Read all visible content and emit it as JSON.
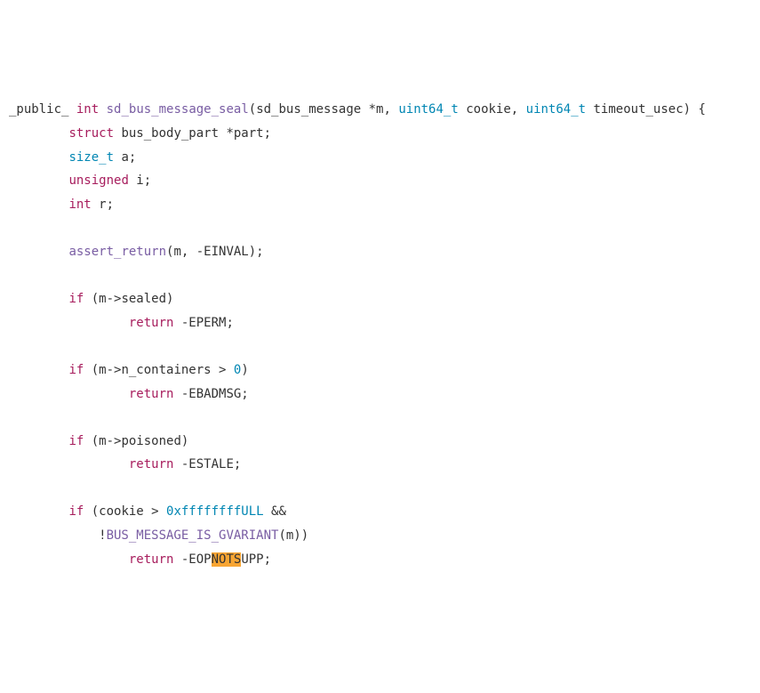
{
  "code": {
    "line1": {
      "modifier": "_public_",
      "kw_int": "int",
      "func": "sd_bus_message_seal",
      "p1": "(sd_bus_message *m, ",
      "type1": "uint64_t",
      "p2": " cookie, ",
      "type2": "uint64_t",
      "p3": " timeout_usec) {"
    },
    "line2": {
      "indent": "        ",
      "kw": "struct",
      "rest": " bus_body_part *part;"
    },
    "line3": {
      "indent": "        ",
      "type": "size_t",
      "rest": " a;"
    },
    "line4": {
      "indent": "        ",
      "kw": "unsigned",
      "rest": " i;"
    },
    "line5": {
      "indent": "        ",
      "kw": "int",
      "rest": " r;"
    },
    "line7": {
      "indent": "        ",
      "func": "assert_return",
      "rest": "(m, -EINVAL);"
    },
    "line9": {
      "indent": "        ",
      "kw": "if",
      "rest": " (m->sealed)"
    },
    "line10": {
      "indent": "                ",
      "kw": "return",
      "rest": " -EPERM;"
    },
    "line12": {
      "indent": "        ",
      "kw": "if",
      "rest": " (m->n_containers > ",
      "num": "0",
      "rest2": ")"
    },
    "line13": {
      "indent": "                ",
      "kw": "return",
      "rest": " -EBADMSG;"
    },
    "line15": {
      "indent": "        ",
      "kw": "if",
      "rest": " (m->poisoned)"
    },
    "line16": {
      "indent": "                ",
      "kw": "return",
      "rest": " -ESTALE;"
    },
    "line18": {
      "indent": "        ",
      "kw": "if",
      "rest": " (cookie > ",
      "num": "0xffffffffULL",
      "rest2": " &&"
    },
    "line19": {
      "indent": "            !",
      "func": "BUS_MESSAGE_IS_GVARIANT",
      "rest": "(m))"
    },
    "line20": {
      "indent": "                ",
      "kw": "return",
      "pre": " -EOP",
      "hl": "NOTS",
      "post": "UPP;"
    }
  }
}
